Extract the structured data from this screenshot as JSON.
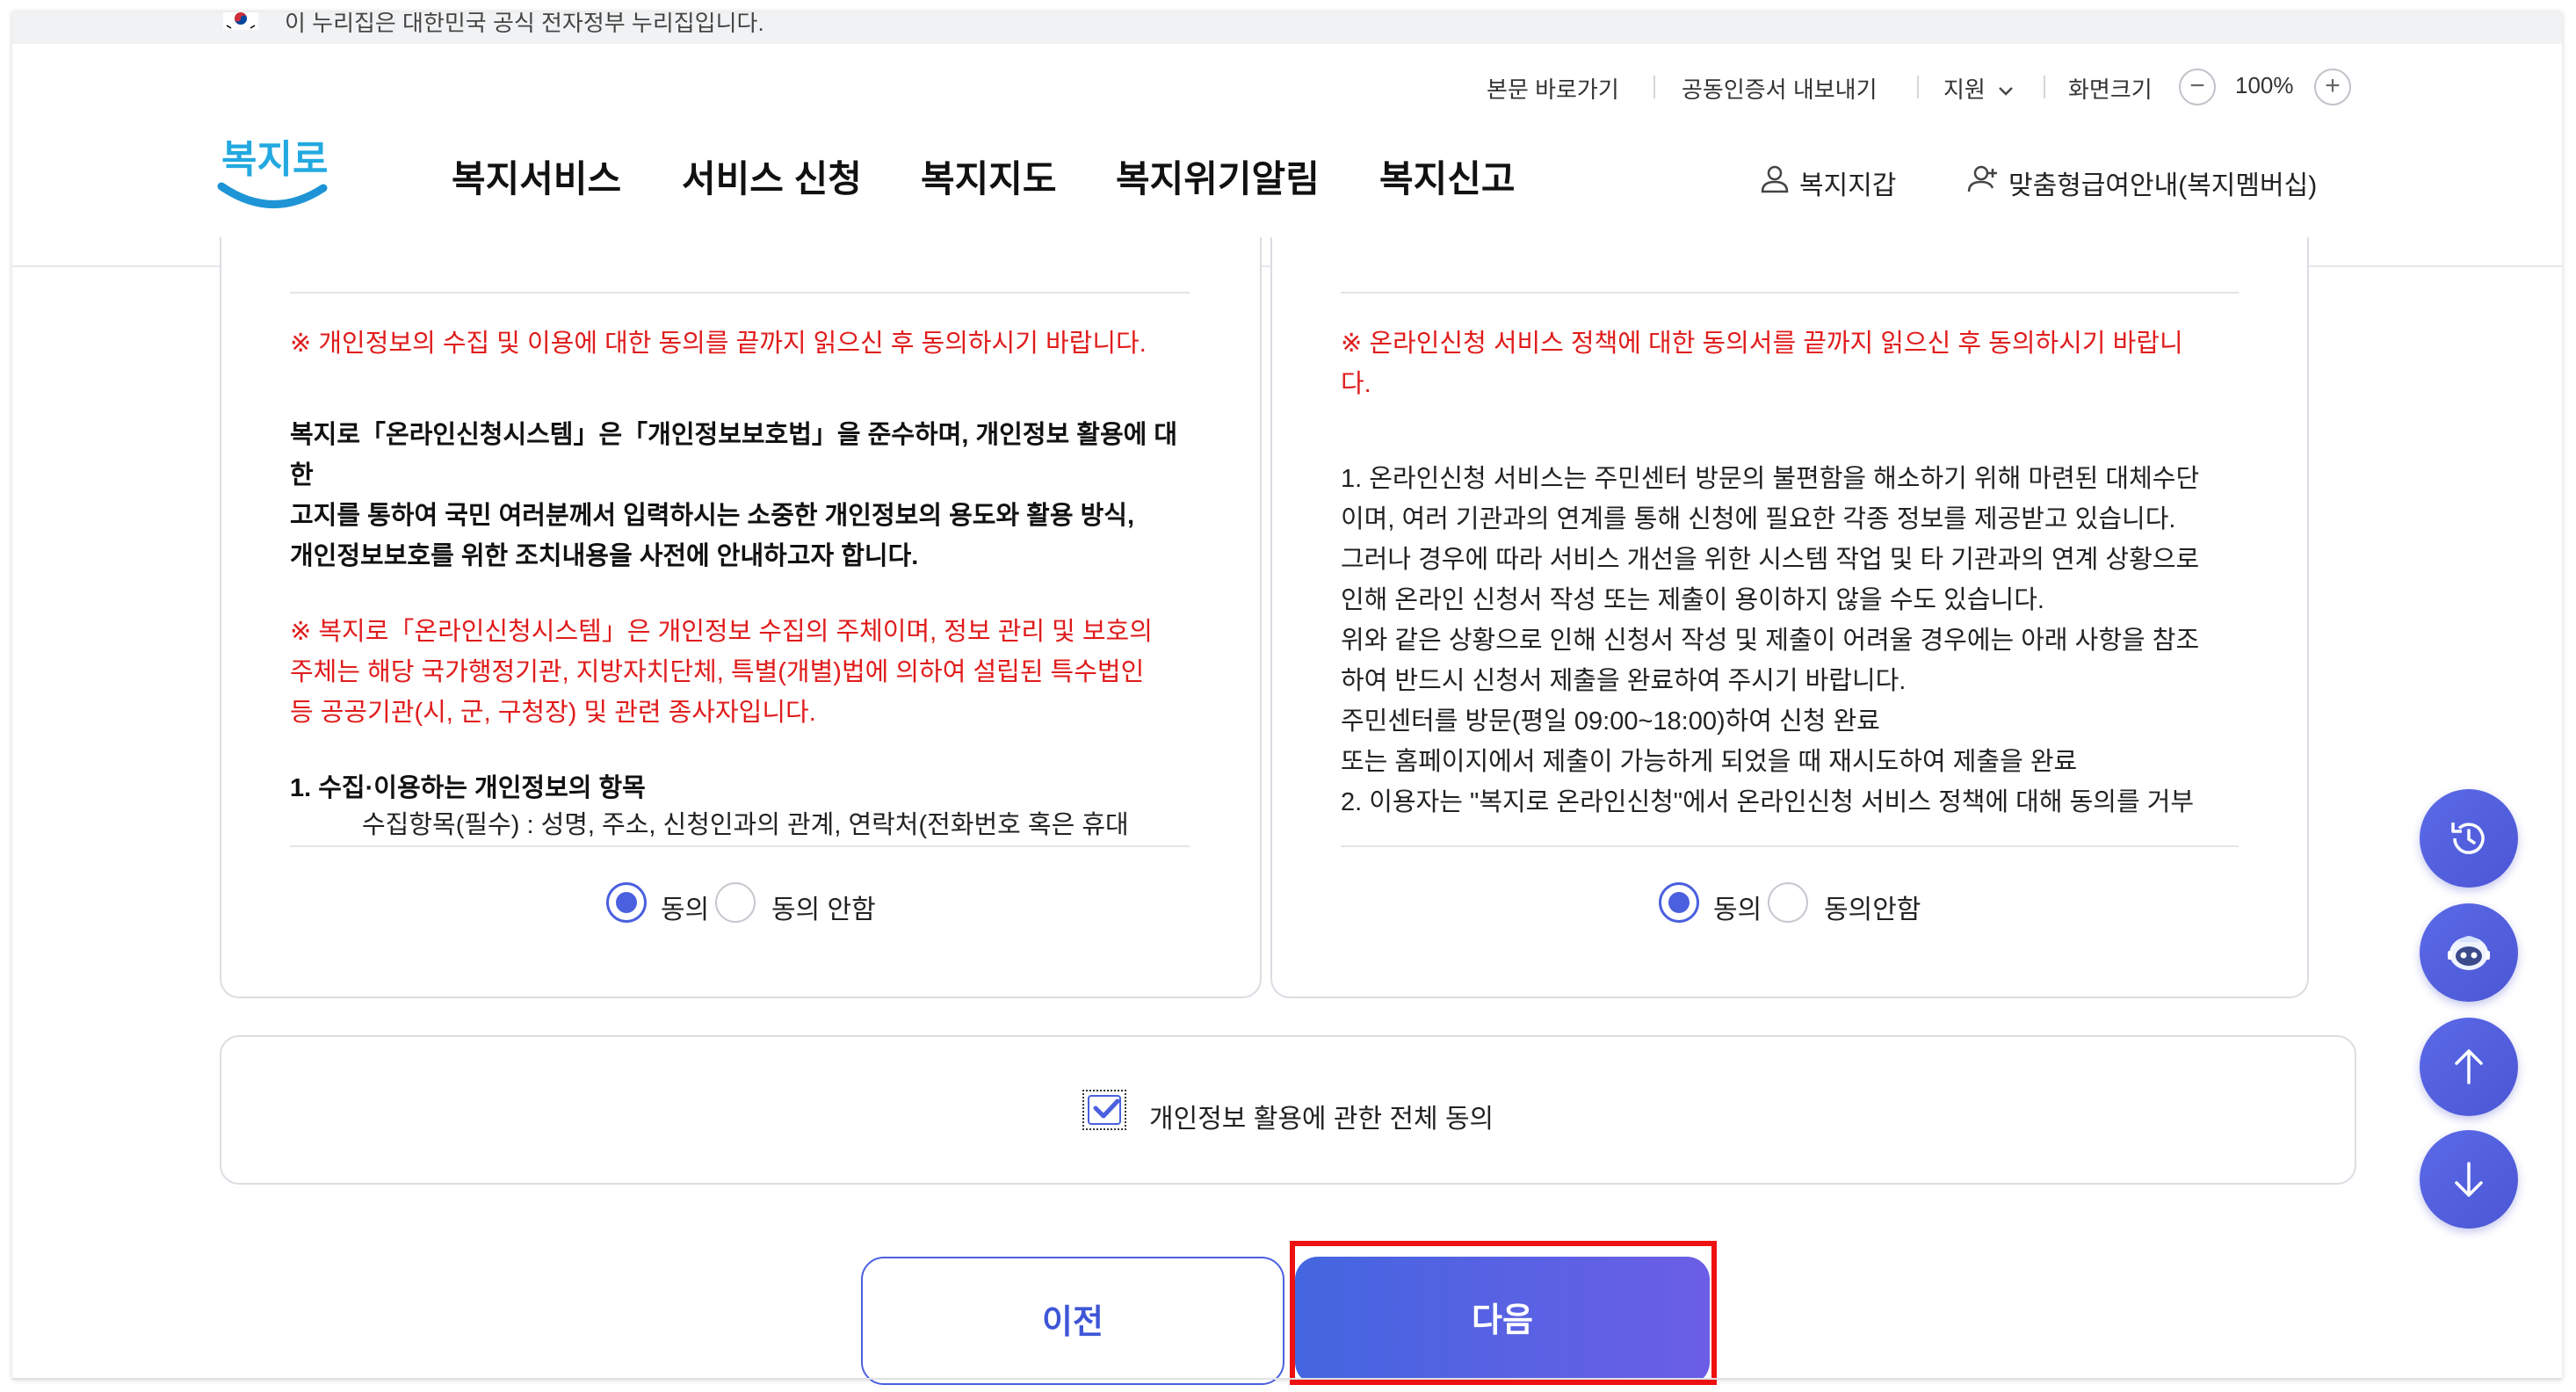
{
  "gov_banner": {
    "text": "이 누리집은 대한민국 공식 전자정부 누리집입니다."
  },
  "utility": {
    "skip_link": "본문 바로가기",
    "cert_export": "공동인증서 내보내기",
    "support": "지원",
    "screen_size": "화면크기",
    "zoom_value": "100%",
    "zoom_out": "−",
    "zoom_in": "+"
  },
  "logo": {
    "text": "복지로"
  },
  "gnb": [
    "복지서비스",
    "서비스 신청",
    "복지지도",
    "복지위기알림",
    "복지신고"
  ],
  "header_links": {
    "wallet": "복지지갑",
    "membership": "맞춤형급여안내(복지멤버십)"
  },
  "left_panel": {
    "notice": "※ 개인정보의 수집 및 이용에 대한 동의를 끝까지 읽으신 후 동의하시기 바랍니다.",
    "intro": [
      "복지로「온라인신청시스템」은「개인정보보호법」을 준수하며, 개인정보 활용에 대한",
      "고지를 통하여 국민 여러분께서 입력하시는 소중한 개인정보의 용도와 활용 방식,",
      "개인정보보호를 위한 조치내용을 사전에 안내하고자 합니다."
    ],
    "notice2": [
      "※ 복지로「온라인신청시스템」은 개인정보 수집의 주체이며, 정보 관리 및 보호의",
      "주체는 해당 국가행정기관, 지방자치단체, 특별(개별)법에 의하여 설립된 특수법인",
      "등 공공기관(시, 군, 구청장) 및 관련 종사자입니다."
    ],
    "section_title": "1. 수집·이용하는 개인정보의 항목",
    "section_cut": "수집항목(필수) : 성명, 주소, 신청인과의 관계, 연락처(전화번호 혹은 휴대",
    "radio_agree": "동의",
    "radio_disagree": "동의 안함"
  },
  "right_panel": {
    "notice": [
      "※ 온라인신청 서비스 정책에 대한 동의서를 끝까지 읽으신 후 동의하시기 바랍니",
      "다."
    ],
    "body": [
      "1. 온라인신청 서비스는 주민센터 방문의 불편함을 해소하기 위해 마련된 대체수단",
      "이며, 여러 기관과의 연계를 통해 신청에 필요한 각종 정보를 제공받고 있습니다.",
      "그러나 경우에 따라 서비스 개선을 위한 시스템 작업 및 타 기관과의 연계 상황으로",
      "인해 온라인 신청서 작성 또는 제출이 용이하지 않을 수도 있습니다.",
      "위와 같은 상황으로 인해 신청서 작성 및 제출이 어려울 경우에는 아래 사항을 참조",
      "하여 반드시 신청서 제출을 완료하여 주시기 바랍니다.",
      "주민센터를 방문(평일 09:00~18:00)하여 신청 완료",
      "또는 홈페이지에서 제출이 가능하게 되었을 때 재시도하여 제출을 완료",
      "2. 이용자는 \"복지로 온라인신청\"에서 온라인신청 서비스 정책에 대해 동의를 거부"
    ],
    "radio_agree": "동의",
    "radio_disagree": "동의안함"
  },
  "agree_all": {
    "label": "개인정보 활용에 관한 전체 동의",
    "checked": true
  },
  "buttons": {
    "prev": "이전",
    "next": "다음"
  },
  "colors": {
    "accent": "#4a60de",
    "notice_red": "#e01b1b",
    "highlight": "#ee1111"
  }
}
